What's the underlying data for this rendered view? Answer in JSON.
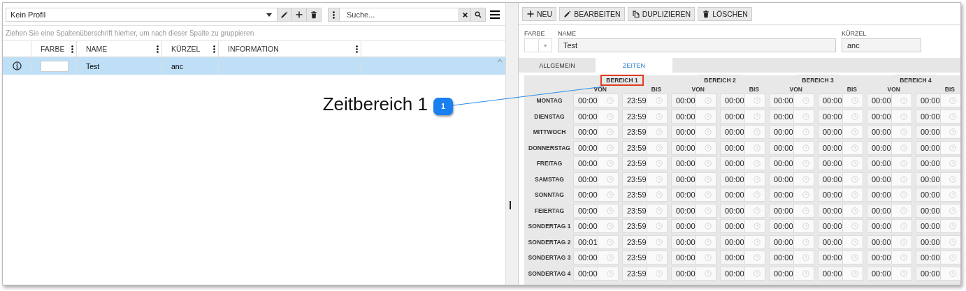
{
  "left_panel": {
    "toolbar": {
      "profile": "Kein Profil",
      "search_placeholder": "Suche..."
    },
    "group_hint": "Ziehen Sie eine Spaltenüberschrift hierher, um nach dieser Spalte zu gruppieren",
    "table": {
      "columns": [
        "FARBE",
        "NAME",
        "KÜRZEL",
        "INFORMATION"
      ],
      "rows": [
        {
          "color": "#ffffff",
          "name": "Test",
          "kuerzel": "anc",
          "selected": true
        }
      ]
    }
  },
  "right_panel": {
    "buttons": [
      {
        "kind": "add",
        "label": "NEU"
      },
      {
        "kind": "edit",
        "label": "BEARBEITEN"
      },
      {
        "kind": "copy",
        "label": "DUPLIZIEREN"
      },
      {
        "kind": "delete",
        "label": "LÖSCHEN"
      }
    ],
    "form": {
      "color_label": "FARBE",
      "name_label": "NAME",
      "name_value": "Test",
      "short_label": "KÜRZEL",
      "short_value": "anc"
    },
    "tabs": [
      {
        "label": "ALLGEMEIN",
        "selected": false
      },
      {
        "label": "ZEITEN",
        "selected": true
      }
    ],
    "areas": [
      {
        "title": "BEREICH 1",
        "highlighted": true,
        "von": "VON",
        "bis": "BIS"
      },
      {
        "title": "BEREICH 2",
        "highlighted": false,
        "von": "VON",
        "bis": "BIS"
      },
      {
        "title": "BEREICH 3",
        "highlighted": false,
        "von": "VON",
        "bis": "BIS"
      },
      {
        "title": "BEREICH 4",
        "highlighted": false,
        "von": "VON",
        "bis": "BIS"
      }
    ],
    "rows": [
      {
        "day": "MONTAG",
        "times": [
          "00:00",
          "23:59",
          "00:00",
          "00:00",
          "00:00",
          "00:00",
          "00:00",
          "00:00"
        ]
      },
      {
        "day": "DIENSTAG",
        "times": [
          "00:00",
          "23:59",
          "00:00",
          "00:00",
          "00:00",
          "00:00",
          "00:00",
          "00:00"
        ]
      },
      {
        "day": "MITTWOCH",
        "times": [
          "00:00",
          "23:59",
          "00:00",
          "00:00",
          "00:00",
          "00:00",
          "00:00",
          "00:00"
        ]
      },
      {
        "day": "DONNERSTAG",
        "times": [
          "00:00",
          "23:59",
          "00:00",
          "00:00",
          "00:00",
          "00:00",
          "00:00",
          "00:00"
        ]
      },
      {
        "day": "FREITAG",
        "times": [
          "00:00",
          "23:59",
          "00:00",
          "00:00",
          "00:00",
          "00:00",
          "00:00",
          "00:00"
        ]
      },
      {
        "day": "SAMSTAG",
        "times": [
          "00:00",
          "23:59",
          "00:00",
          "00:00",
          "00:00",
          "00:00",
          "00:00",
          "00:00"
        ]
      },
      {
        "day": "SONNTAG",
        "times": [
          "00:00",
          "23:59",
          "00:00",
          "00:00",
          "00:00",
          "00:00",
          "00:00",
          "00:00"
        ]
      },
      {
        "day": "FEIERTAG",
        "times": [
          "00:00",
          "23:59",
          "00:00",
          "00:00",
          "00:00",
          "00:00",
          "00:00",
          "00:00"
        ]
      },
      {
        "day": "SONDERTAG 1",
        "times": [
          "00:00",
          "23:59",
          "00:00",
          "00:00",
          "00:00",
          "00:00",
          "00:00",
          "00:00"
        ]
      },
      {
        "day": "SONDERTAG 2",
        "times": [
          "00:01",
          "23:59",
          "00:00",
          "00:00",
          "00:00",
          "00:00",
          "00:00",
          "00:00"
        ]
      },
      {
        "day": "SONDERTAG 3",
        "times": [
          "00:00",
          "23:59",
          "00:00",
          "00:00",
          "00:00",
          "00:00",
          "00:00",
          "00:00"
        ]
      },
      {
        "day": "SONDERTAG 4",
        "times": [
          "00:00",
          "23:59",
          "00:00",
          "00:00",
          "00:00",
          "00:00",
          "00:00",
          "00:00"
        ]
      }
    ]
  },
  "callout": {
    "label": "Zeitbereich 1",
    "badge": "1"
  }
}
